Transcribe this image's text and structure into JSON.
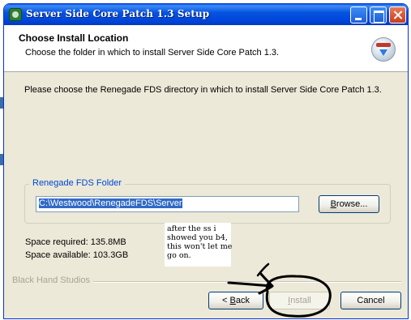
{
  "window": {
    "title": "Server Side Core Patch 1.3 Setup"
  },
  "header": {
    "title": "Choose Install Location",
    "subtitle": "Choose the folder in which to install Server Side Core Patch 1.3."
  },
  "main": {
    "instruction": "Please choose the Renegade FDS directory in which to install Server Side Core Patch 1.3.",
    "group_label": "Renegade FDS Folder",
    "path_value": "C:\\Westwood\\RenegadeFDS\\Server",
    "browse_label": "Browse...",
    "space_required": "Space required: 135.8MB",
    "space_available": "Space available: 103.3GB"
  },
  "footer": {
    "brand": "Black Hand Studios",
    "back_label": "< Back",
    "install_label": "Install",
    "cancel_label": "Cancel",
    "install_enabled": false
  },
  "annotation": {
    "note": "after the ss i\nshowed you b4,\nthis won't let me\ngo on."
  },
  "colors": {
    "titlebar": "#0054e3",
    "dialog_bg": "#ece9d8",
    "group_label": "#0046d5",
    "selection": "#316ac5",
    "disabled_text": "#a8a497"
  },
  "icons": [
    "installer-icon",
    "minimize-icon",
    "maximize-icon",
    "close-icon",
    "installer-logo-icon"
  ]
}
